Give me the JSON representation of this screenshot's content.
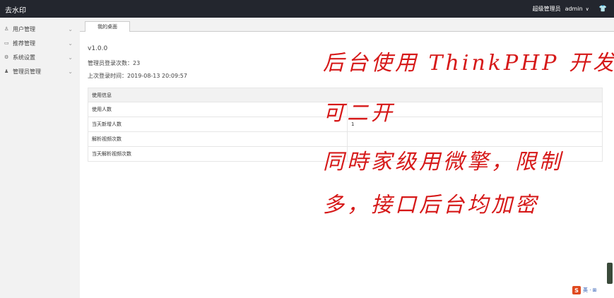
{
  "topbar": {
    "brand": "去水印",
    "role": "超级管理员",
    "user": "admin",
    "user_chevron": "∨",
    "shirt_icon": "👕"
  },
  "sidebar": {
    "items": [
      {
        "label": "用户管理",
        "icon": "user-icon"
      },
      {
        "label": "推荐管理",
        "icon": "document-icon"
      },
      {
        "label": "系统设置",
        "icon": "gear-icon"
      },
      {
        "label": "管理员管理",
        "icon": "admin-icon"
      }
    ]
  },
  "tabs": [
    {
      "label": "我的桌面"
    }
  ],
  "dashboard": {
    "version": "v1.0.0",
    "login_count": "管理员登录次数：23",
    "last_login": "上次登录时间：2019-08-13 20:09:57"
  },
  "table": {
    "header": "使用信息",
    "rows": [
      {
        "label": "使用人数",
        "value": ""
      },
      {
        "label": "当天新增人数",
        "value": "1"
      },
      {
        "label": "解析视频次数",
        "value": ""
      },
      {
        "label": "当天解析视频次数",
        "value": ""
      }
    ]
  },
  "overlay": {
    "line1": "后台使用 ThinkPHP 开发",
    "line2": "可二开",
    "line3": "同時家级用微擎，限制",
    "line4": "多，接口后台均加密"
  },
  "ime": {
    "logo": "S",
    "text": "英 · ⊞"
  },
  "colors": {
    "topbar": "#23262e",
    "overlay_text": "#d61919"
  }
}
